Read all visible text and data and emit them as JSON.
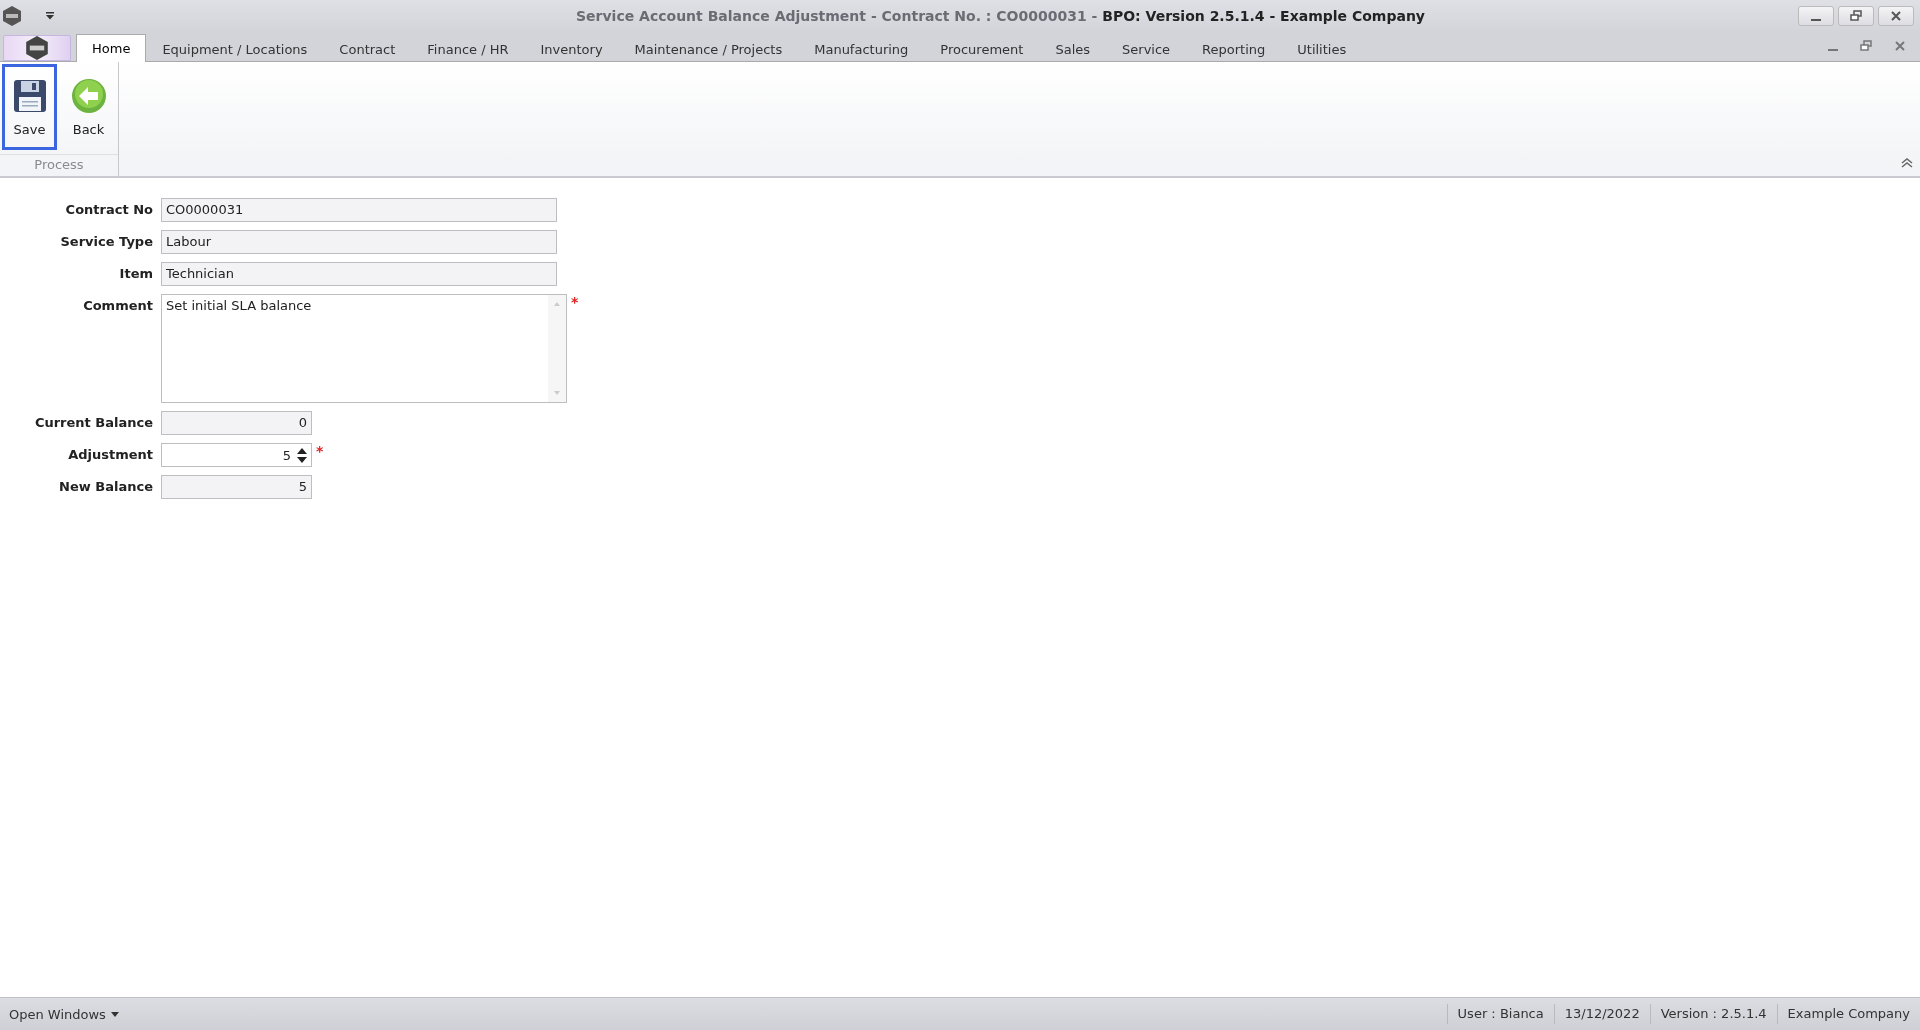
{
  "window": {
    "title": "Service Account Balance Adjustment - Contract No. : CO0000031 - **BPO: Version 2.5.1.4 - Example Company**"
  },
  "tabs": [
    {
      "label": "Home",
      "selected": true
    },
    {
      "label": "Equipment / Locations",
      "selected": false
    },
    {
      "label": "Contract",
      "selected": false
    },
    {
      "label": "Finance / HR",
      "selected": false
    },
    {
      "label": "Inventory",
      "selected": false
    },
    {
      "label": "Maintenance / Projects",
      "selected": false
    },
    {
      "label": "Manufacturing",
      "selected": false
    },
    {
      "label": "Procurement",
      "selected": false
    },
    {
      "label": "Sales",
      "selected": false
    },
    {
      "label": "Service",
      "selected": false
    },
    {
      "label": "Reporting",
      "selected": false
    },
    {
      "label": "Utilities",
      "selected": false
    }
  ],
  "ribbon": {
    "groups": [
      {
        "label": "Process",
        "buttons": [
          {
            "label": "Save",
            "kind": "save",
            "focused": true
          },
          {
            "label": "Back",
            "kind": "back",
            "focused": false
          }
        ]
      }
    ]
  },
  "form": {
    "fields": [
      {
        "label": "Contract No",
        "kind": "text",
        "value": "CO0000031",
        "readonly": true
      },
      {
        "label": "Service Type",
        "kind": "text",
        "value": "Labour",
        "readonly": true
      },
      {
        "label": "Item",
        "kind": "text",
        "value": "Technician",
        "readonly": true
      },
      {
        "label": "Comment",
        "kind": "memo",
        "value": "Set initial SLA balance",
        "readonly": false,
        "required_mark": "*"
      },
      {
        "label": "Current Balance",
        "kind": "number",
        "value": "0",
        "readonly": true
      },
      {
        "label": "Adjustment",
        "kind": "spin",
        "value": "5",
        "readonly": false,
        "required_mark": "*"
      },
      {
        "label": "New Balance",
        "kind": "number",
        "value": "5",
        "readonly": true
      }
    ]
  },
  "status_bar": {
    "open_windows": "Open Windows",
    "items": [
      "User : Bianca",
      "13/12/2022",
      "Version : 2.5.1.4",
      "Example Company"
    ]
  }
}
